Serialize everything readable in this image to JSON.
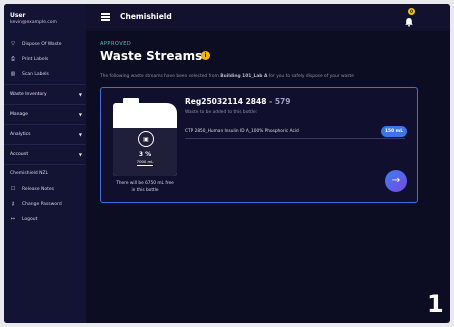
{
  "user": {
    "name": "User",
    "email": "kevin@example.com"
  },
  "sidebar": {
    "top_items": [
      {
        "label": "Dispose Of Waste",
        "icon": "filter-icon"
      },
      {
        "label": "Print Labels",
        "icon": "printer-icon"
      },
      {
        "label": "Scan Labels",
        "icon": "barcode-icon"
      }
    ],
    "sections": [
      "Waste Inventory",
      "Manage",
      "Analytics",
      "Account"
    ],
    "app_label": "Chemishield NZL",
    "bottom_items": [
      {
        "label": "Release Notes",
        "icon": "notes-icon"
      },
      {
        "label": "Change Password",
        "icon": "key-icon"
      },
      {
        "label": "Logout",
        "icon": "logout-icon"
      }
    ]
  },
  "header": {
    "title": "Chemishield",
    "notification_count": "0"
  },
  "main": {
    "status": "APPROVED",
    "title": "Waste Streams",
    "info_icon": "i",
    "description_prefix": "The following waste streams have been selected from ",
    "description_location": "Building 101_Lab A",
    "description_suffix": " for you to safely dispose of your waste"
  },
  "panel": {
    "bottle_percent": "3 %",
    "bottle_capacity": "7000 mL",
    "bottle_fill_fraction": 0.03,
    "free_text_line1": "There will be 6750 mL free",
    "free_text_line2": "in this bottle",
    "reg_id": "Reg25032114 2848",
    "reg_suffix": "- 579",
    "waste_label": "Waste to be added to this bottle:",
    "chemical": "CTP 2850_Human Insulin ID A_100% Phosphoric Acid",
    "quantity": "150 mL",
    "next_arrow": "→"
  },
  "page_number": "1"
}
